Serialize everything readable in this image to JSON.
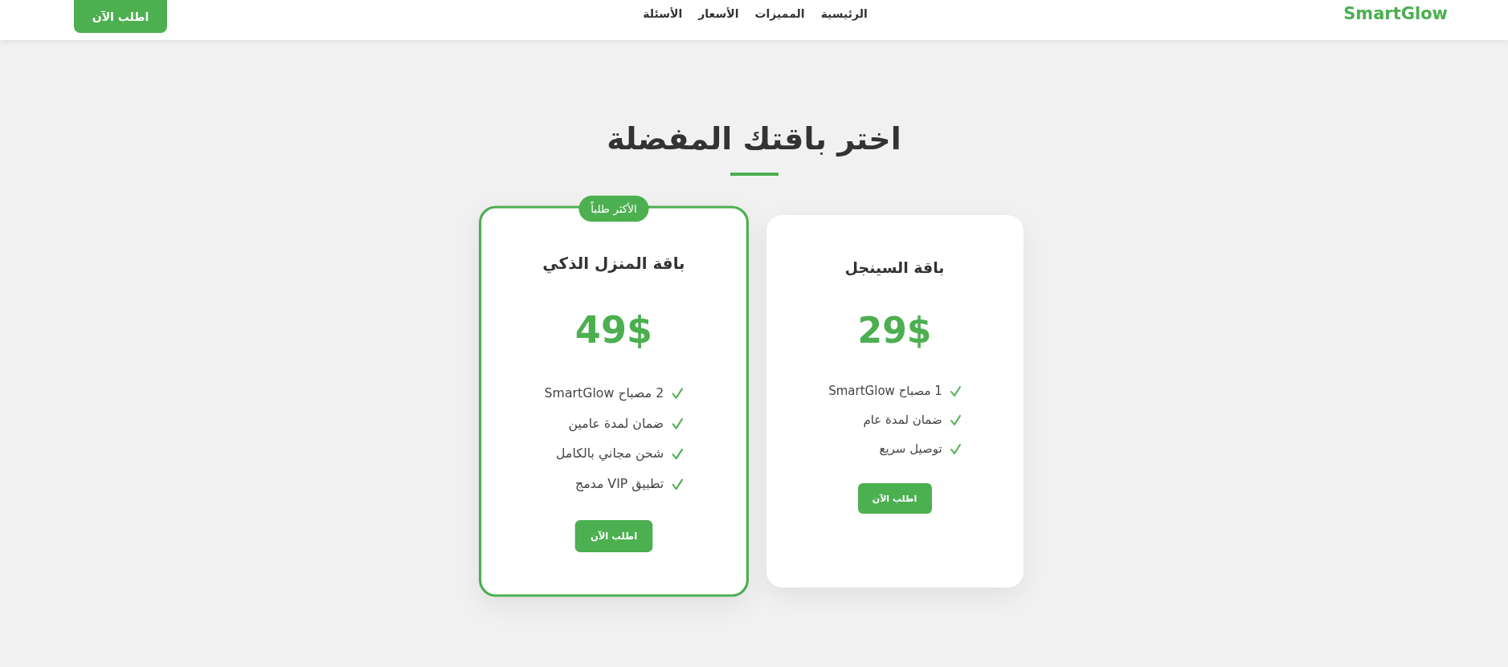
{
  "header": {
    "logo": "SmartGlow",
    "nav": [
      {
        "label": "الرئيسية"
      },
      {
        "label": "المميزات"
      },
      {
        "label": "الأسعار"
      },
      {
        "label": "الأسئلة"
      }
    ],
    "cta": "اطلب الآن"
  },
  "pricing": {
    "title": "اختر باقتك المفضلة",
    "plans": [
      {
        "name": "باقة السينجل",
        "price": "29$",
        "featured": false,
        "features": [
          "1 مصباح SmartGlow",
          "ضمان لمدة عام",
          "توصيل سريع"
        ],
        "button": "اطلب الآن"
      },
      {
        "name": "باقة المنزل الذكي",
        "price": "49$",
        "featured": true,
        "badge": "الأكثر طلباً",
        "features": [
          "2 مصباح SmartGlow",
          "ضمان لمدة عامين",
          "شحن مجاني بالكامل",
          "تطبيق VIP مدمج"
        ],
        "button": "اطلب الآن"
      }
    ]
  }
}
